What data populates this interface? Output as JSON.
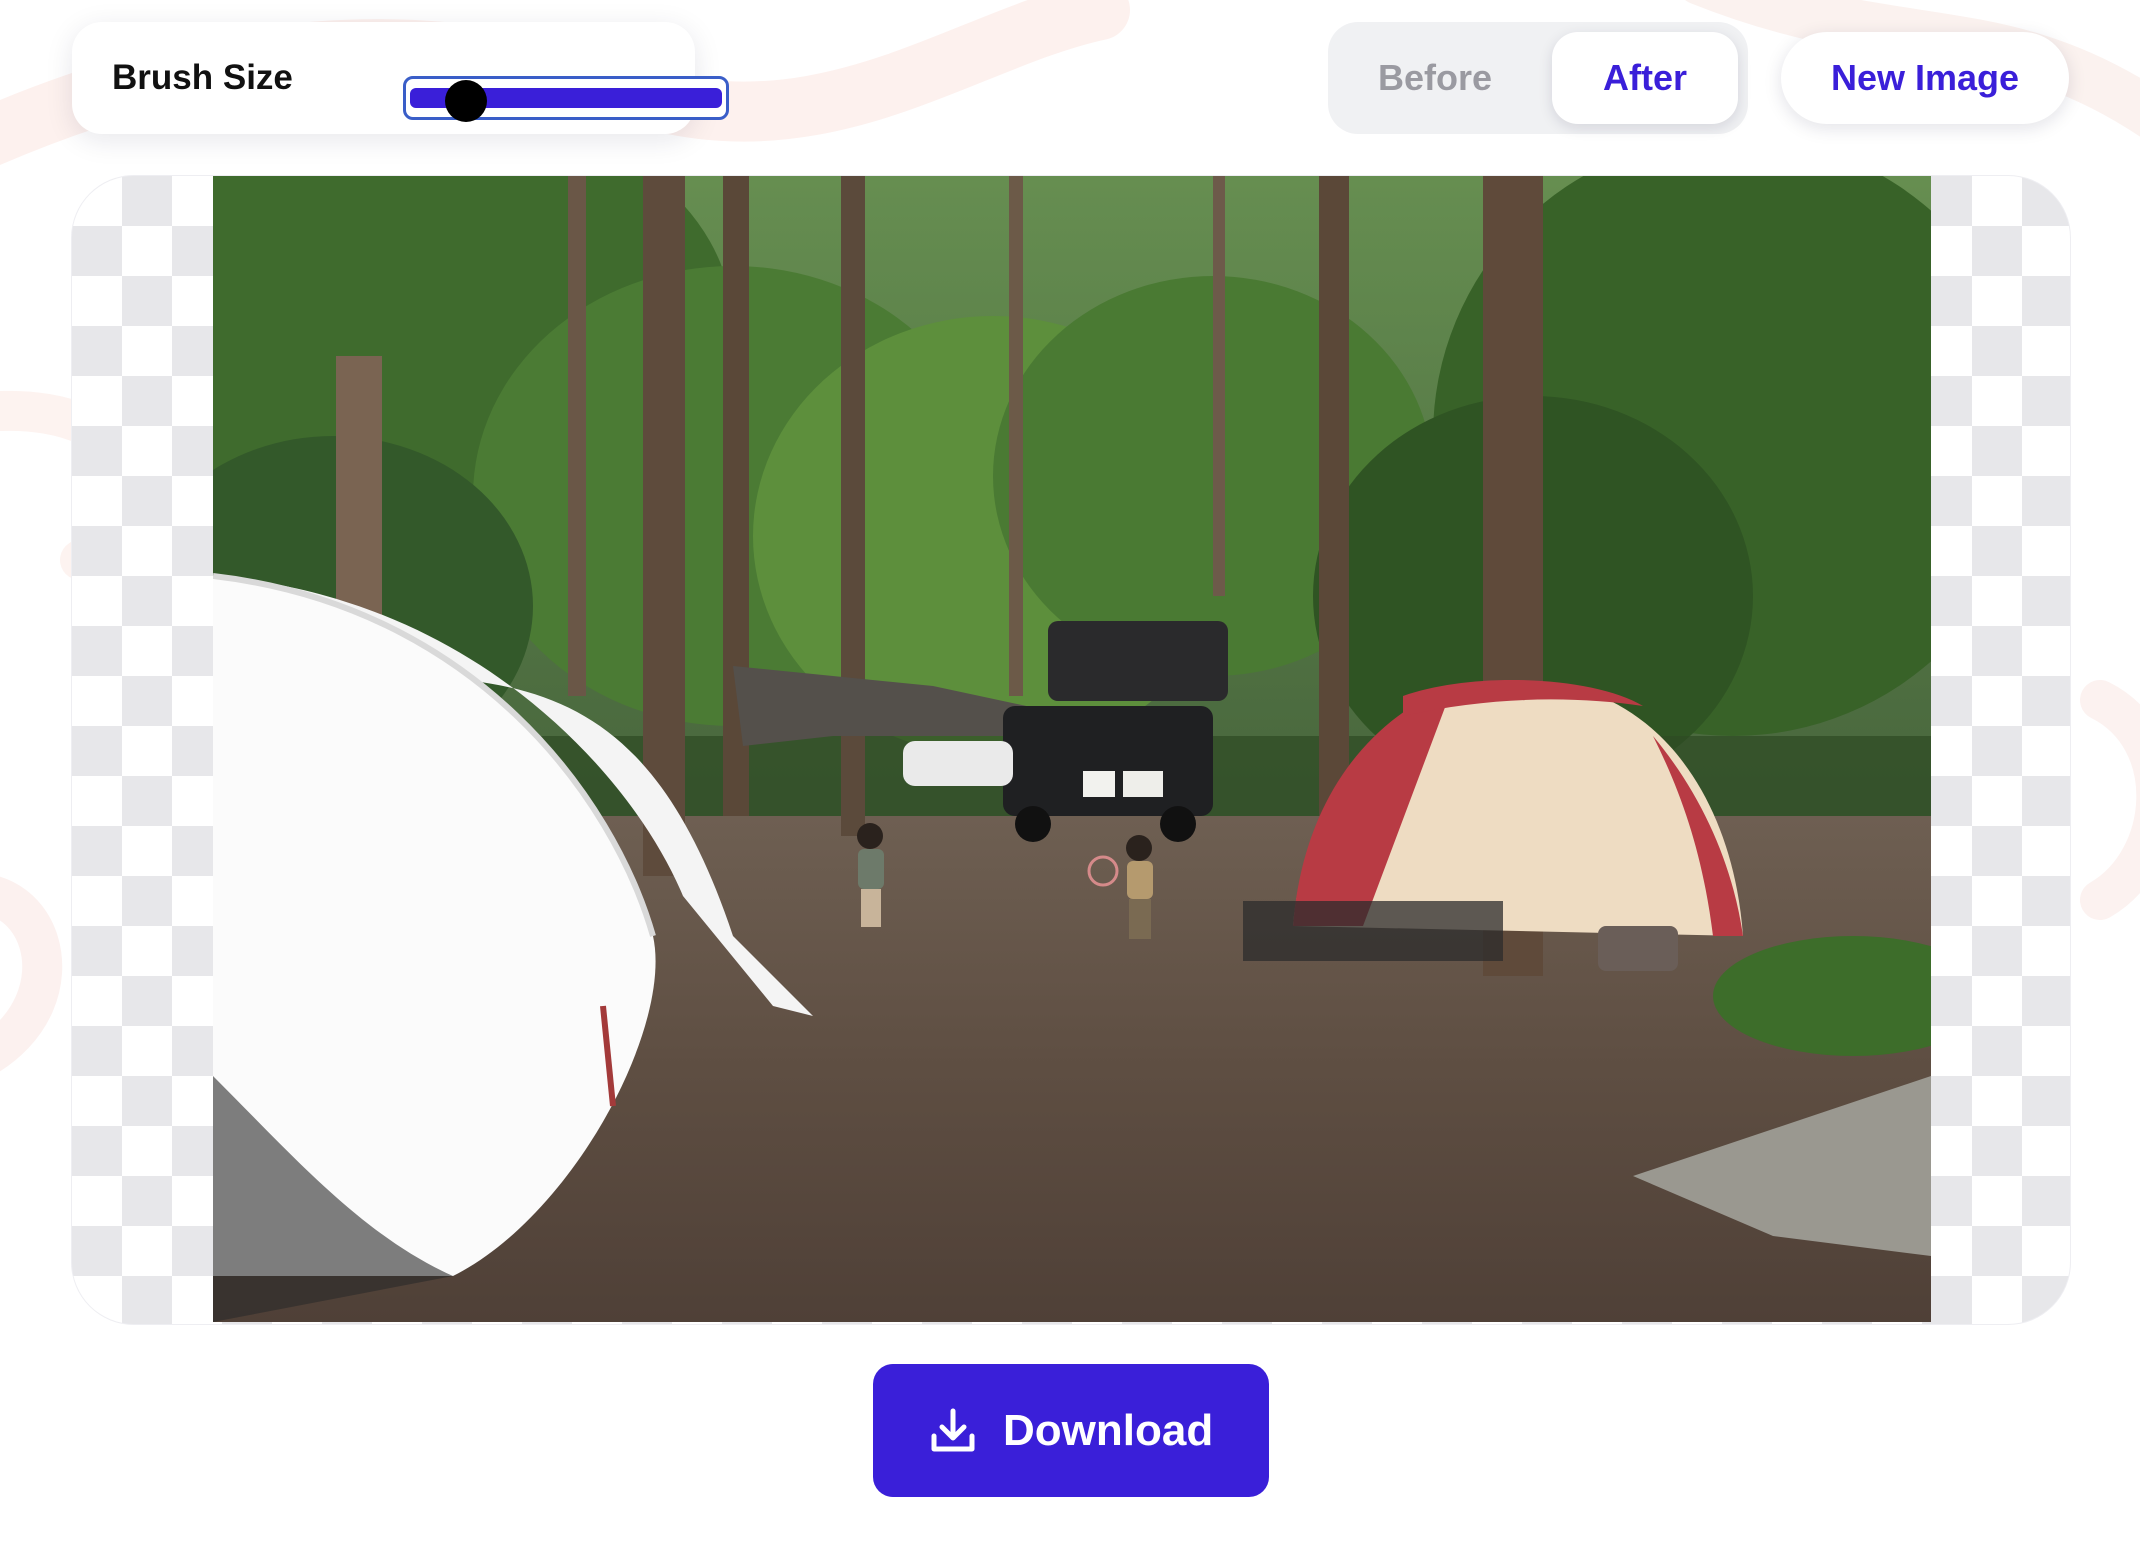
{
  "brush": {
    "label": "Brush Size",
    "value_fraction": 0.14,
    "track_color": "#3a1fd9",
    "border_color": "#3a5ec8",
    "thumb_color": "#000000"
  },
  "view_toggle": {
    "before_label": "Before",
    "after_label": "After",
    "selected": "After"
  },
  "new_image_label": "New Image",
  "download_label": "Download",
  "colors": {
    "accent": "#3a1fd9",
    "muted_text": "#9a9aa1",
    "checker": "#e7e7ea"
  },
  "icons": {
    "download": "download-icon"
  }
}
